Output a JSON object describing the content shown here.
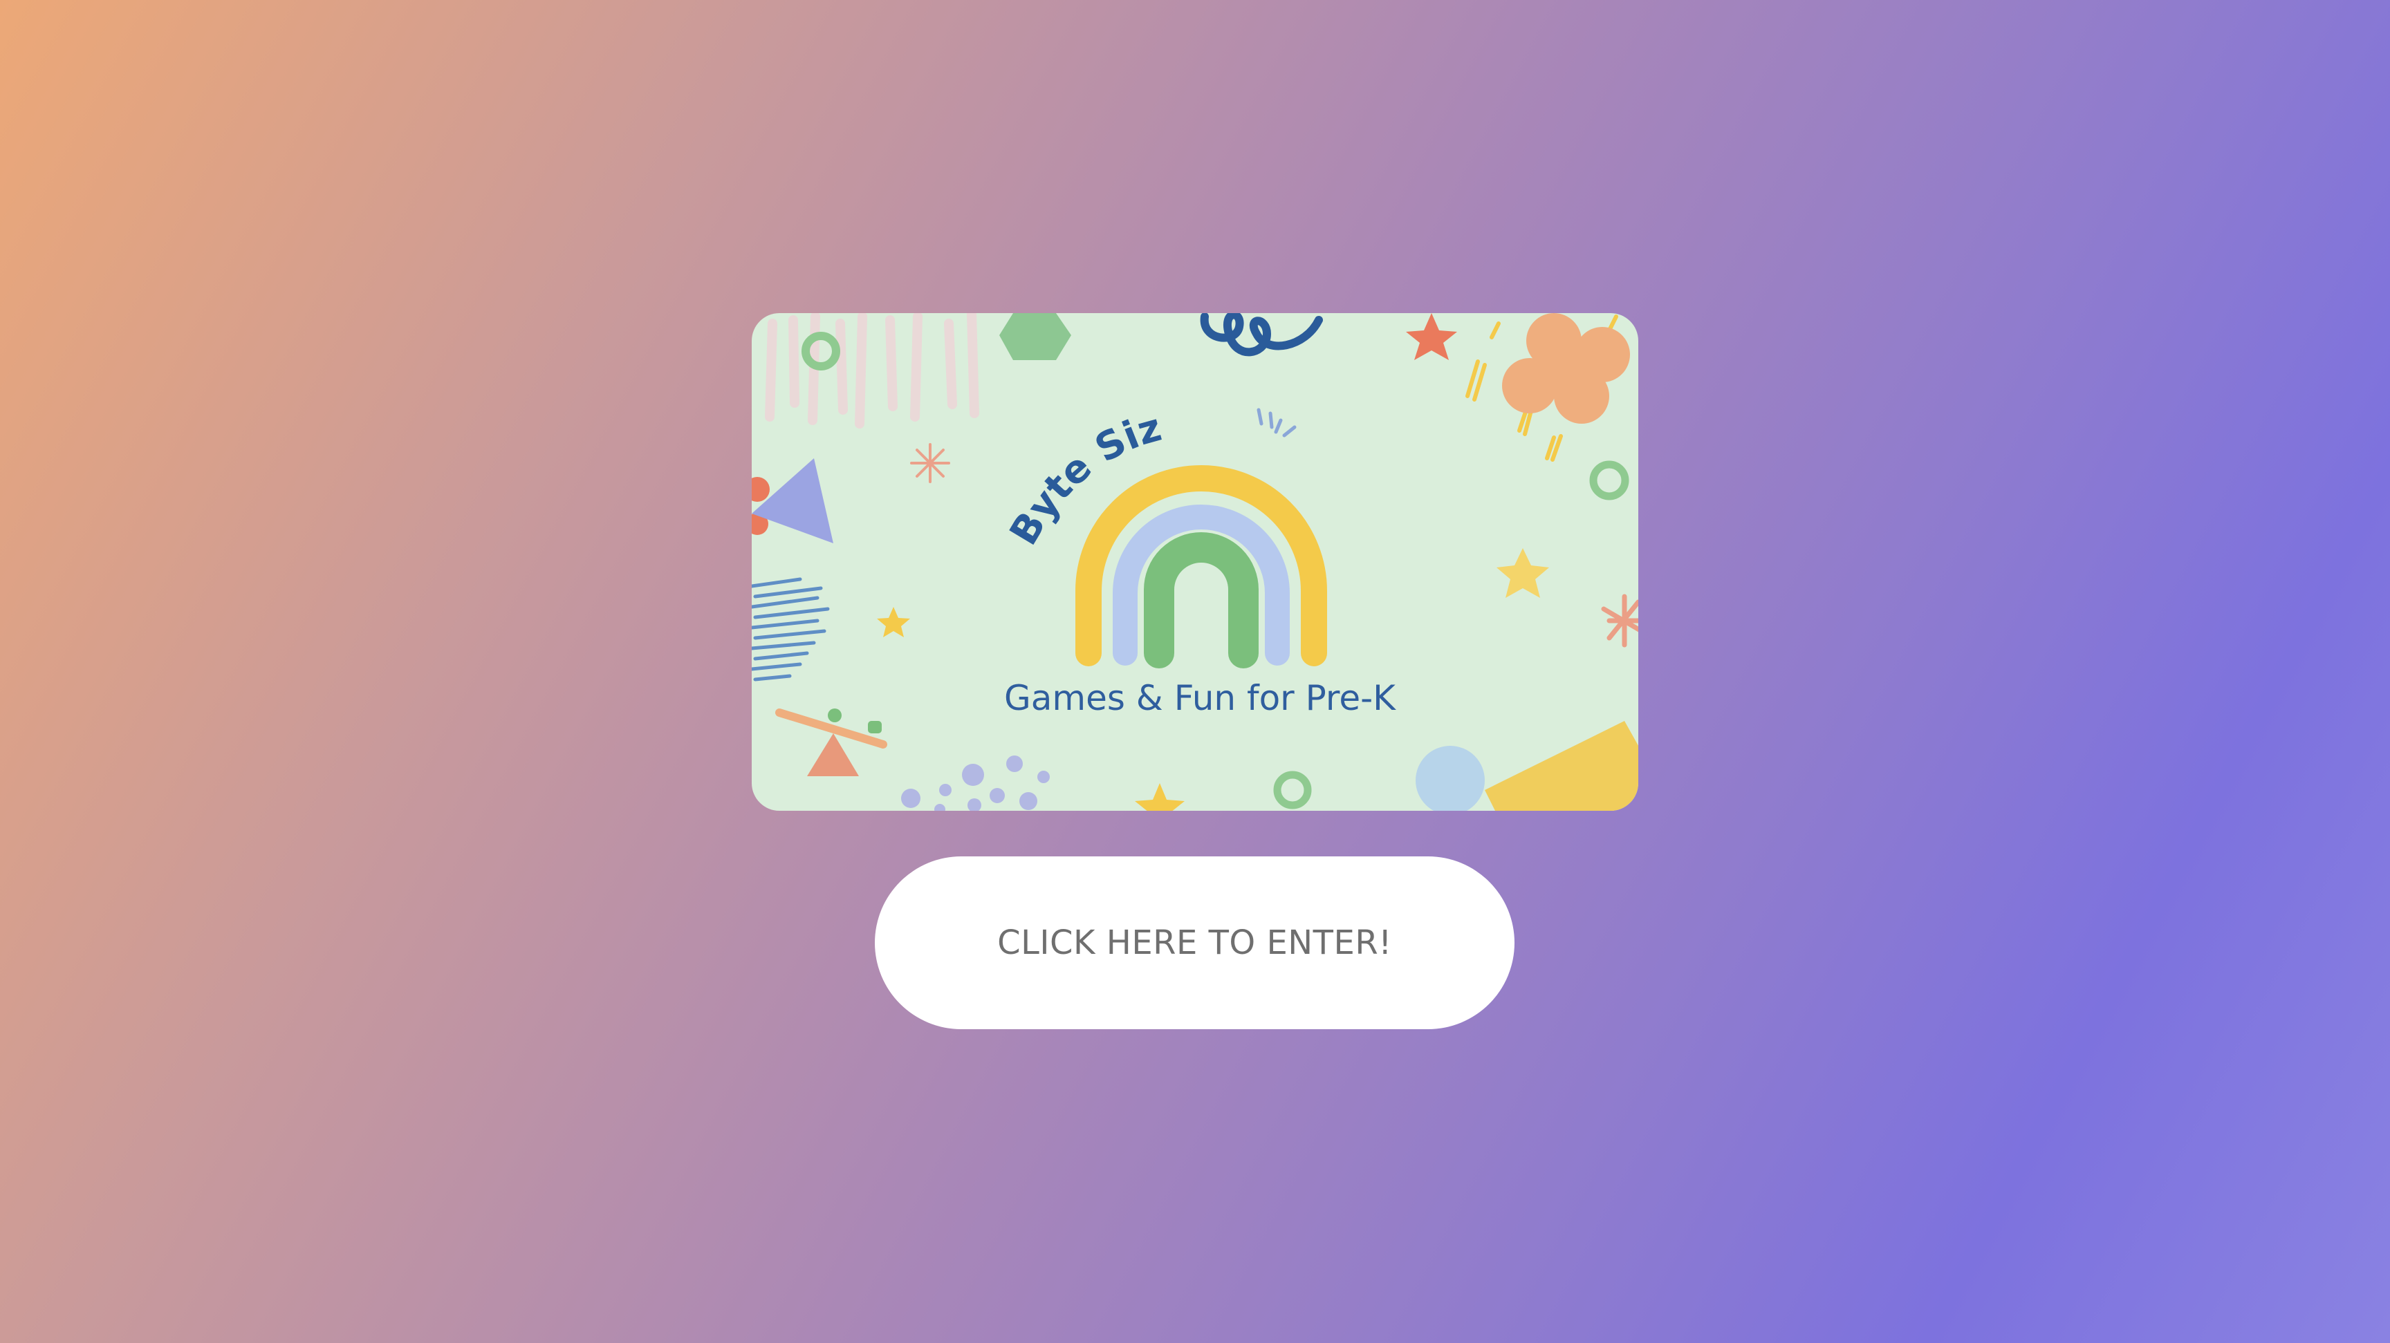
{
  "banner": {
    "brand_text": "Byte Size",
    "tagline": "Games & Fun for Pre-K"
  },
  "enter_button": {
    "label": "CLICK HERE TO ENTER!"
  },
  "colors": {
    "background_start": "#eca877",
    "background_end": "#7d72de",
    "banner_bg": "#daeedb",
    "brand_blue": "#2a5b9a",
    "rainbow_outer": "#f4ca4a",
    "rainbow_middle": "#b6c9ee",
    "rainbow_inner": "#7bbf7c",
    "button_bg": "#ffffff",
    "button_text": "#6f6f6f"
  },
  "icons": {
    "logo": "rainbow-icon",
    "decorations": [
      "star-icon",
      "ring-icon",
      "hexagon-icon",
      "triangle-icon",
      "flower-icon",
      "seesaw-icon",
      "squiggle-icon"
    ]
  }
}
